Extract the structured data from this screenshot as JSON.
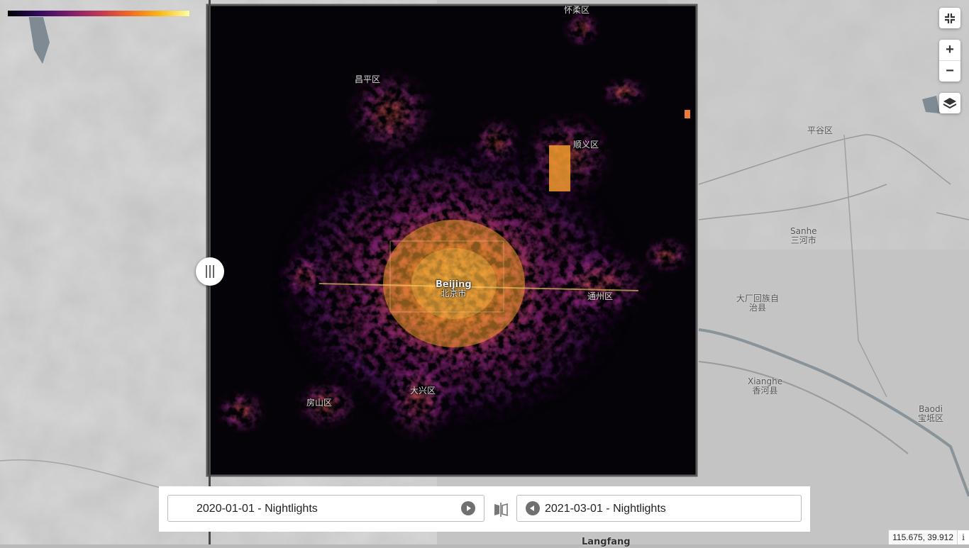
{
  "colors": {
    "basemap": "#bababa",
    "night_bg": "#050307",
    "accent": "#fbb61a"
  },
  "colorbar": {
    "palette": "inferno"
  },
  "controls": {
    "fullscreen_icon": "compress-icon",
    "zoom_in": "+",
    "zoom_out": "−",
    "layers_icon": "layers-icon"
  },
  "labels": {
    "huairou": "怀柔区",
    "changping": "昌平区",
    "shunyi": "顺义区",
    "pinggu": "平谷区",
    "sanhe_en": "Sanhe",
    "sanhe_zh": "三河市",
    "beijing_en": "Beijing",
    "beijing_zh": "北京市",
    "tongzhou": "通州区",
    "dachang_1": "大厂回族自",
    "dachang_2": "治县",
    "xianghe_en": "Xianghe",
    "xianghe_zh": "香河县",
    "baodi_en": "Baodi",
    "baodi_zh": "宝坻区",
    "daxing": "大兴区",
    "fangshan": "房山区",
    "langfang": "Langfang"
  },
  "compare": {
    "left_label": "2020-01-01 - Nightlights",
    "right_label": "2021-03-01 - Nightlights",
    "swap_icon": "swap-compare-icon"
  },
  "status": {
    "coords": "115.675, 39.912",
    "info": "i"
  }
}
